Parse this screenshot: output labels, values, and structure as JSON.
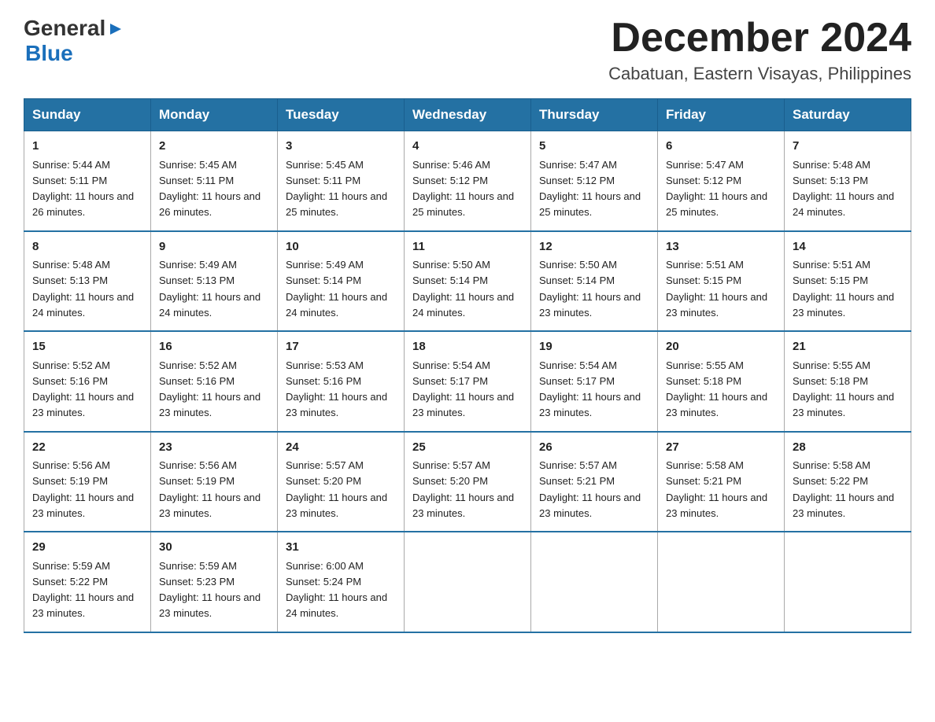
{
  "header": {
    "logo": {
      "general": "General",
      "blue": "Blue"
    },
    "title": "December 2024",
    "subtitle": "Cabatuan, Eastern Visayas, Philippines"
  },
  "weekdays": [
    "Sunday",
    "Monday",
    "Tuesday",
    "Wednesday",
    "Thursday",
    "Friday",
    "Saturday"
  ],
  "weeks": [
    [
      {
        "day": "1",
        "sunrise": "5:44 AM",
        "sunset": "5:11 PM",
        "daylight": "11 hours and 26 minutes."
      },
      {
        "day": "2",
        "sunrise": "5:45 AM",
        "sunset": "5:11 PM",
        "daylight": "11 hours and 26 minutes."
      },
      {
        "day": "3",
        "sunrise": "5:45 AM",
        "sunset": "5:11 PM",
        "daylight": "11 hours and 25 minutes."
      },
      {
        "day": "4",
        "sunrise": "5:46 AM",
        "sunset": "5:12 PM",
        "daylight": "11 hours and 25 minutes."
      },
      {
        "day": "5",
        "sunrise": "5:47 AM",
        "sunset": "5:12 PM",
        "daylight": "11 hours and 25 minutes."
      },
      {
        "day": "6",
        "sunrise": "5:47 AM",
        "sunset": "5:12 PM",
        "daylight": "11 hours and 25 minutes."
      },
      {
        "day": "7",
        "sunrise": "5:48 AM",
        "sunset": "5:13 PM",
        "daylight": "11 hours and 24 minutes."
      }
    ],
    [
      {
        "day": "8",
        "sunrise": "5:48 AM",
        "sunset": "5:13 PM",
        "daylight": "11 hours and 24 minutes."
      },
      {
        "day": "9",
        "sunrise": "5:49 AM",
        "sunset": "5:13 PM",
        "daylight": "11 hours and 24 minutes."
      },
      {
        "day": "10",
        "sunrise": "5:49 AM",
        "sunset": "5:14 PM",
        "daylight": "11 hours and 24 minutes."
      },
      {
        "day": "11",
        "sunrise": "5:50 AM",
        "sunset": "5:14 PM",
        "daylight": "11 hours and 24 minutes."
      },
      {
        "day": "12",
        "sunrise": "5:50 AM",
        "sunset": "5:14 PM",
        "daylight": "11 hours and 23 minutes."
      },
      {
        "day": "13",
        "sunrise": "5:51 AM",
        "sunset": "5:15 PM",
        "daylight": "11 hours and 23 minutes."
      },
      {
        "day": "14",
        "sunrise": "5:51 AM",
        "sunset": "5:15 PM",
        "daylight": "11 hours and 23 minutes."
      }
    ],
    [
      {
        "day": "15",
        "sunrise": "5:52 AM",
        "sunset": "5:16 PM",
        "daylight": "11 hours and 23 minutes."
      },
      {
        "day": "16",
        "sunrise": "5:52 AM",
        "sunset": "5:16 PM",
        "daylight": "11 hours and 23 minutes."
      },
      {
        "day": "17",
        "sunrise": "5:53 AM",
        "sunset": "5:16 PM",
        "daylight": "11 hours and 23 minutes."
      },
      {
        "day": "18",
        "sunrise": "5:54 AM",
        "sunset": "5:17 PM",
        "daylight": "11 hours and 23 minutes."
      },
      {
        "day": "19",
        "sunrise": "5:54 AM",
        "sunset": "5:17 PM",
        "daylight": "11 hours and 23 minutes."
      },
      {
        "day": "20",
        "sunrise": "5:55 AM",
        "sunset": "5:18 PM",
        "daylight": "11 hours and 23 minutes."
      },
      {
        "day": "21",
        "sunrise": "5:55 AM",
        "sunset": "5:18 PM",
        "daylight": "11 hours and 23 minutes."
      }
    ],
    [
      {
        "day": "22",
        "sunrise": "5:56 AM",
        "sunset": "5:19 PM",
        "daylight": "11 hours and 23 minutes."
      },
      {
        "day": "23",
        "sunrise": "5:56 AM",
        "sunset": "5:19 PM",
        "daylight": "11 hours and 23 minutes."
      },
      {
        "day": "24",
        "sunrise": "5:57 AM",
        "sunset": "5:20 PM",
        "daylight": "11 hours and 23 minutes."
      },
      {
        "day": "25",
        "sunrise": "5:57 AM",
        "sunset": "5:20 PM",
        "daylight": "11 hours and 23 minutes."
      },
      {
        "day": "26",
        "sunrise": "5:57 AM",
        "sunset": "5:21 PM",
        "daylight": "11 hours and 23 minutes."
      },
      {
        "day": "27",
        "sunrise": "5:58 AM",
        "sunset": "5:21 PM",
        "daylight": "11 hours and 23 minutes."
      },
      {
        "day": "28",
        "sunrise": "5:58 AM",
        "sunset": "5:22 PM",
        "daylight": "11 hours and 23 minutes."
      }
    ],
    [
      {
        "day": "29",
        "sunrise": "5:59 AM",
        "sunset": "5:22 PM",
        "daylight": "11 hours and 23 minutes."
      },
      {
        "day": "30",
        "sunrise": "5:59 AM",
        "sunset": "5:23 PM",
        "daylight": "11 hours and 23 minutes."
      },
      {
        "day": "31",
        "sunrise": "6:00 AM",
        "sunset": "5:24 PM",
        "daylight": "11 hours and 24 minutes."
      },
      null,
      null,
      null,
      null
    ]
  ]
}
